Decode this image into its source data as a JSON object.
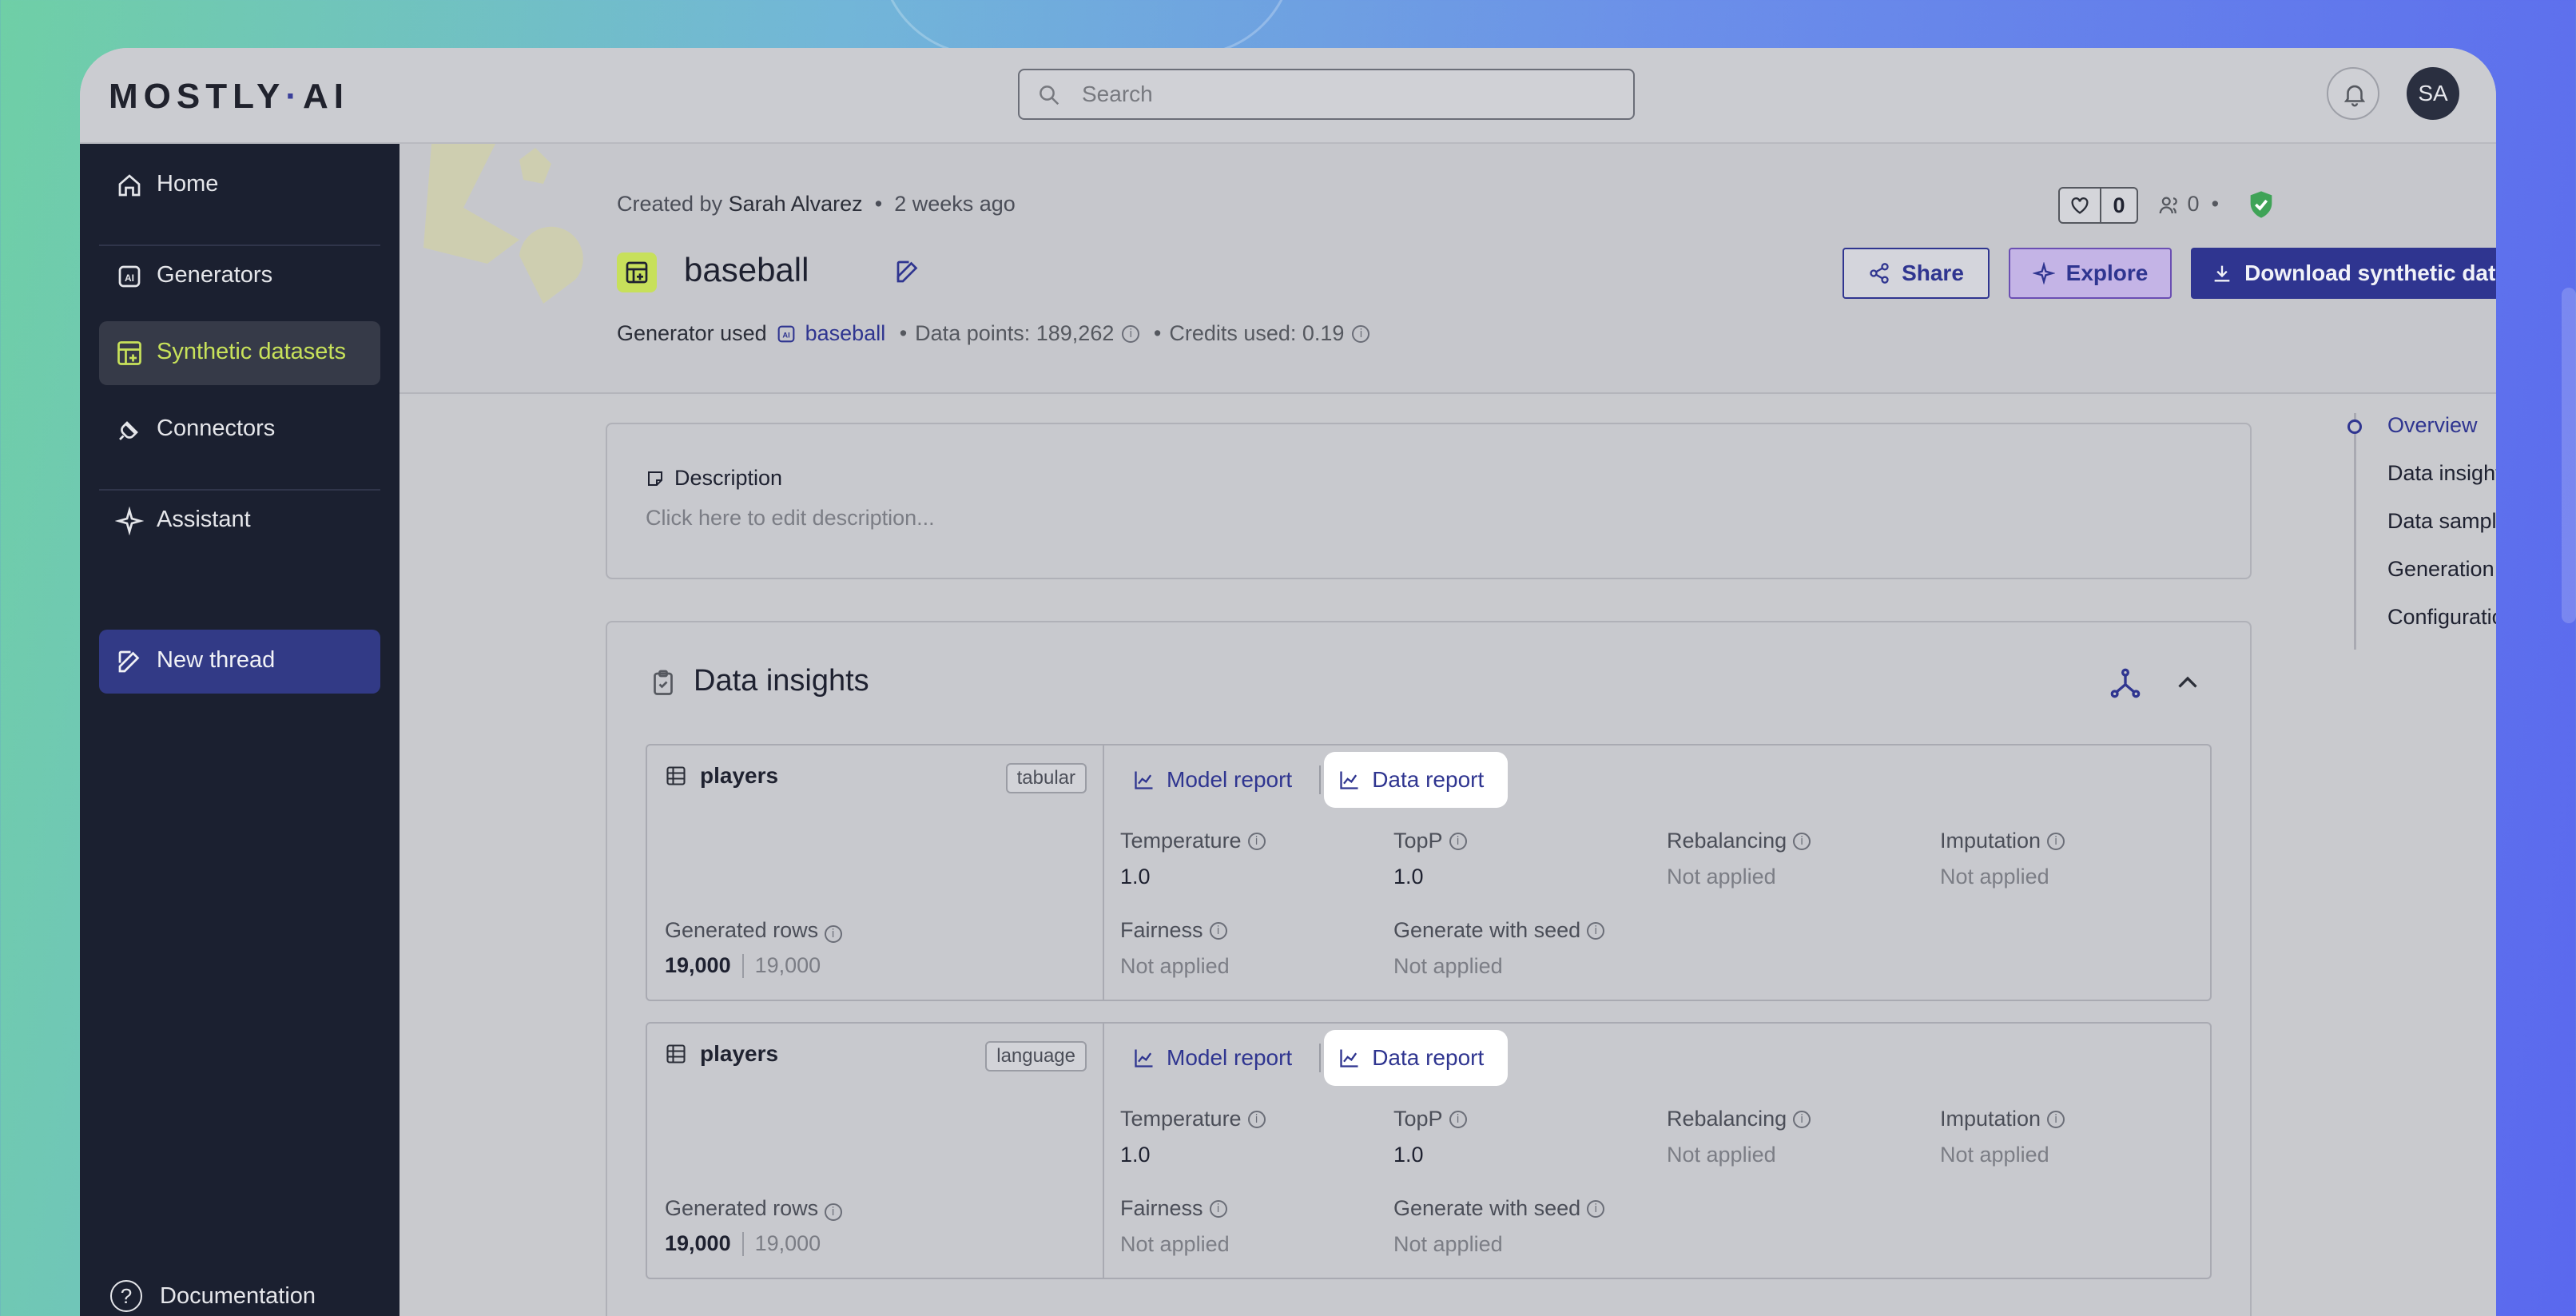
{
  "logo": {
    "left": "MOSTLY",
    "dot": "·",
    "right": "AI"
  },
  "search": {
    "placeholder": "Search"
  },
  "user": {
    "initials": "SA"
  },
  "sidebar": {
    "items": [
      {
        "label": "Home",
        "icon": "home-icon"
      },
      {
        "label": "Generators",
        "icon": "ai-chip-icon"
      },
      {
        "label": "Synthetic datasets",
        "icon": "table-plus-icon"
      },
      {
        "label": "Connectors",
        "icon": "plug-icon"
      },
      {
        "label": "Assistant",
        "icon": "sparkle-icon"
      },
      {
        "label": "New thread",
        "icon": "edit-icon"
      }
    ],
    "documentation": "Documentation"
  },
  "dataset": {
    "created_prefix": "Created by",
    "author": "Sarah Alvarez",
    "created_when": "2 weeks ago",
    "likes": "0",
    "shares": "0",
    "name": "baseball",
    "generator_label": "Generator used",
    "generator_name": "baseball",
    "data_points": "Data points: 189,262",
    "credits": "Credits used: 0.19"
  },
  "actions": {
    "share": "Share",
    "explore": "Explore",
    "download": "Download synthetic data"
  },
  "description": {
    "heading": "Description",
    "placeholder": "Click here to edit description..."
  },
  "insights": {
    "title": "Data insights",
    "tables": [
      {
        "name": "players",
        "tag": "tabular",
        "model_report": "Model report",
        "data_report": "Data report",
        "generated_rows_label": "Generated rows",
        "rows": "19,000",
        "rows_total": "19,000",
        "params": [
          {
            "label": "Temperature",
            "value": "1.0"
          },
          {
            "label": "TopP",
            "value": "1.0"
          },
          {
            "label": "Rebalancing",
            "value": "Not applied"
          },
          {
            "label": "Imputation",
            "value": "Not applied"
          },
          {
            "label": "Fairness",
            "value": "Not applied"
          },
          {
            "label": "Generate with seed",
            "value": "Not applied"
          }
        ]
      },
      {
        "name": "players",
        "tag": "language",
        "model_report": "Model report",
        "data_report": "Data report",
        "generated_rows_label": "Generated rows",
        "rows": "19,000",
        "rows_total": "19,000",
        "params": [
          {
            "label": "Temperature",
            "value": "1.0"
          },
          {
            "label": "TopP",
            "value": "1.0"
          },
          {
            "label": "Rebalancing",
            "value": "Not applied"
          },
          {
            "label": "Imputation",
            "value": "Not applied"
          },
          {
            "label": "Fairness",
            "value": "Not applied"
          },
          {
            "label": "Generate with seed",
            "value": "Not applied"
          }
        ]
      }
    ]
  },
  "toc": [
    "Overview",
    "Data insights",
    "Data samples",
    "Generation status",
    "Configuration"
  ],
  "colors": {
    "accent": "#2f3590",
    "active_nav": "#c8e25a",
    "sidebar": "#1b2030"
  }
}
